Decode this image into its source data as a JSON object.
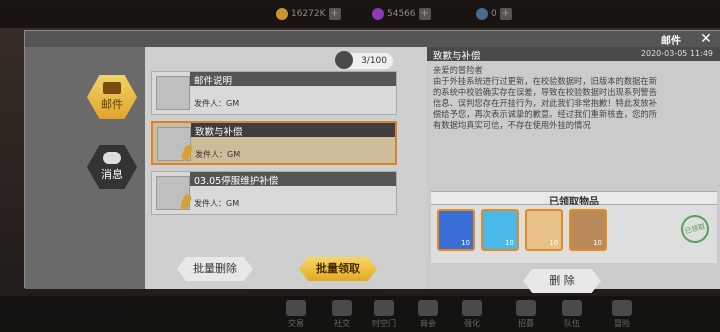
{
  "topbar": {
    "resource1": "16272K",
    "resource2": "54566",
    "resource3": "0"
  },
  "header": {
    "title": "邮件",
    "close": "✕"
  },
  "tabs": [
    {
      "label": "邮件",
      "active": true
    },
    {
      "label": "消息",
      "active": false
    }
  ],
  "count": "3/100",
  "mails": [
    {
      "title": "邮件说明",
      "sender": "发件人：GM",
      "selected": false,
      "has_attachment": false
    },
    {
      "title": "致歉与补偿",
      "sender": "发件人：GM",
      "selected": true,
      "has_attachment": true
    },
    {
      "title": "03.05停服维护补偿",
      "sender": "发件人：GM",
      "selected": false,
      "has_attachment": true
    }
  ],
  "buttons": {
    "batch_delete": "批量删除",
    "batch_claim": "批量领取",
    "delete": "删 除"
  },
  "detail": {
    "title": "致歉与补偿",
    "date": "2020-03-05  11:49",
    "body": "亲爱的冒险者\n由于外挂系统进行过更新，在校验数据时，旧版本的数据在新的系统中校验确实存在误差，导致在校验数据时出现系列警告信息、误判您存在开挂行为，对此我们非常抱歉！特此发放补偿给予您，再次表示诚挚的歉意。经过我们重新核查，您的所有数据均真实可信，不存在使用外挂的情况"
  },
  "claimed": {
    "title": "已领取物品",
    "stamp": "已领取",
    "items": [
      {
        "name": "card-item",
        "qty": "10",
        "color": "#3a6fd8"
      },
      {
        "name": "crystal-item",
        "qty": "10",
        "color": "#4ab8e8"
      },
      {
        "name": "ore-item",
        "qty": "10",
        "color": "#e8c08a"
      },
      {
        "name": "chest-item",
        "qty": "10",
        "color": "#b88a5a"
      }
    ]
  },
  "nav": [
    "交易",
    "社交",
    "时空门",
    "商会",
    "强化",
    "招募",
    "队伍",
    "冒险"
  ]
}
